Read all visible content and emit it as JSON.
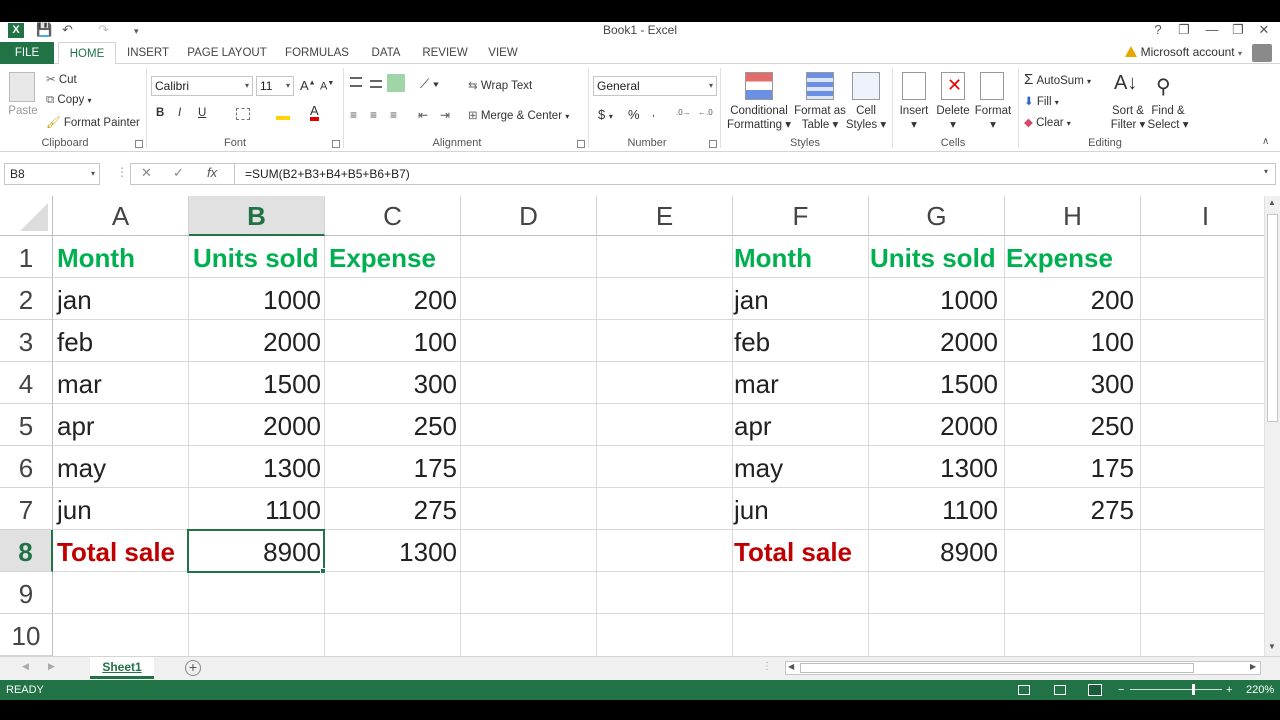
{
  "window": {
    "title": "Book1 - Excel",
    "logo": "X",
    "buttons": [
      "?",
      "❐",
      "—",
      "❐",
      "✕"
    ]
  },
  "tabs": [
    "FILE",
    "HOME",
    "INSERT",
    "PAGE LAYOUT",
    "FORMULAS",
    "DATA",
    "REVIEW",
    "VIEW"
  ],
  "account": "Microsoft account",
  "ribbon": {
    "clipboard": {
      "paste": "Paste",
      "cut": "Cut",
      "copy": "Copy",
      "format_painter": "Format Painter",
      "label": "Clipboard"
    },
    "font": {
      "name": "Calibri",
      "size": "11",
      "bold": "B",
      "italic": "I",
      "underline": "U",
      "label": "Font"
    },
    "alignment": {
      "wrap_text": "Wrap Text",
      "merge_center": "Merge & Center",
      "label": "Alignment"
    },
    "number": {
      "format": "General",
      "currency": "$",
      "percent": "%",
      "label": "Number"
    },
    "styles": {
      "conditional": "Conditional",
      "conditional2": "Formatting",
      "format_as": "Format as",
      "format_as2": "Table",
      "cell": "Cell",
      "cell2": "Styles",
      "label": "Styles"
    },
    "cells": {
      "insert": "Insert",
      "delete": "Delete",
      "format": "Format",
      "label": "Cells"
    },
    "editing": {
      "autosum": "AutoSum",
      "fill": "Fill",
      "clear": "Clear",
      "sort": "Sort &",
      "sort2": "Filter",
      "find": "Find &",
      "find2": "Select",
      "label": "Editing"
    }
  },
  "formula_bar": {
    "name_box": "B8",
    "fx": "fx",
    "formula": "=SUM(B2+B3+B4+B5+B6+B7)"
  },
  "columns": [
    "A",
    "B",
    "C",
    "D",
    "E",
    "F",
    "G",
    "H",
    "I"
  ],
  "rows": [
    "1",
    "2",
    "3",
    "4",
    "5",
    "6",
    "7",
    "8",
    "9",
    "10"
  ],
  "table_left": {
    "headers": [
      "Month",
      "Units sold",
      "Expense"
    ],
    "rows": [
      [
        "jan",
        "1000",
        "200"
      ],
      [
        "feb",
        "2000",
        "100"
      ],
      [
        "mar",
        "1500",
        "300"
      ],
      [
        "apr",
        "2000",
        "250"
      ],
      [
        "may",
        "1300",
        "175"
      ],
      [
        "jun",
        "1100",
        "275"
      ]
    ],
    "total": [
      "Total sale",
      "8900",
      "1300"
    ]
  },
  "table_right": {
    "headers": [
      "Month",
      "Units sold",
      "Expense"
    ],
    "rows": [
      [
        "jan",
        "1000",
        "200"
      ],
      [
        "feb",
        "2000",
        "100"
      ],
      [
        "mar",
        "1500",
        "300"
      ],
      [
        "apr",
        "2000",
        "250"
      ],
      [
        "may",
        "1300",
        "175"
      ],
      [
        "jun",
        "1100",
        "275"
      ]
    ],
    "total": [
      "Total sale",
      "8900",
      ""
    ]
  },
  "sheet_tab": "Sheet1",
  "status": {
    "mode": "READY",
    "zoom": "220%"
  },
  "colors": {
    "excel_green": "#217346",
    "header_green": "#00b050",
    "total_red": "#c00000"
  }
}
